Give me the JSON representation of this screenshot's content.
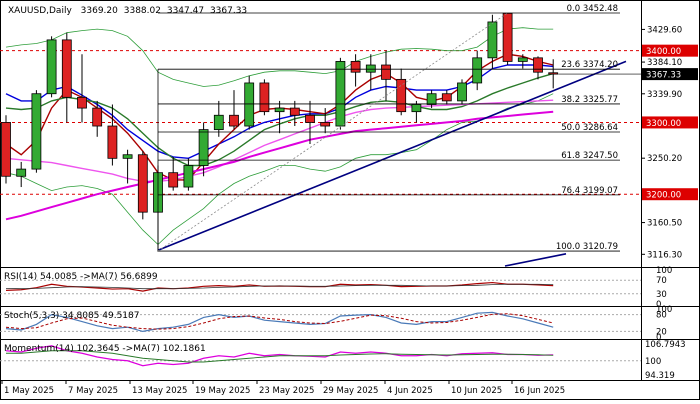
{
  "header": {
    "symbol": "XAUUSD,Daily",
    "open": "3369.20",
    "high": "3388.02",
    "low": "3347.47",
    "close": "3367.33"
  },
  "colors": {
    "bull": "#33aa33",
    "bear": "#dd2222",
    "bb": "#2e9e3a",
    "ma_fast": "#0000dd",
    "ma_red": "#aa0000",
    "ma_green": "#2a7a2a",
    "ma_pink": "#ee55ee",
    "ma_magenta": "#dd00dd",
    "trendline": "#000080",
    "level_red": "#dd0000"
  },
  "chart_data": {
    "type": "candlestick",
    "title": "XAUUSD,Daily",
    "ylim": [
      3100,
      3465
    ],
    "candles": [
      {
        "o": 3300,
        "h": 3310,
        "l": 3215,
        "c": 3225
      },
      {
        "o": 3225,
        "h": 3245,
        "l": 3210,
        "c": 3235
      },
      {
        "o": 3235,
        "h": 3345,
        "l": 3230,
        "c": 3340
      },
      {
        "o": 3340,
        "h": 3420,
        "l": 3335,
        "c": 3415
      },
      {
        "o": 3415,
        "h": 3425,
        "l": 3300,
        "c": 3335
      },
      {
        "o": 3335,
        "h": 3395,
        "l": 3300,
        "c": 3320
      },
      {
        "o": 3320,
        "h": 3330,
        "l": 3280,
        "c": 3295
      },
      {
        "o": 3295,
        "h": 3325,
        "l": 3240,
        "c": 3250
      },
      {
        "o": 3250,
        "h": 3262,
        "l": 3215,
        "c": 3255
      },
      {
        "o": 3255,
        "h": 3260,
        "l": 3165,
        "c": 3175
      },
      {
        "o": 3175,
        "h": 3240,
        "l": 3120,
        "c": 3230
      },
      {
        "o": 3230,
        "h": 3252,
        "l": 3205,
        "c": 3210
      },
      {
        "o": 3210,
        "h": 3250,
        "l": 3205,
        "c": 3240
      },
      {
        "o": 3240,
        "h": 3300,
        "l": 3225,
        "c": 3290
      },
      {
        "o": 3290,
        "h": 3330,
        "l": 3280,
        "c": 3310
      },
      {
        "o": 3310,
        "h": 3345,
        "l": 3290,
        "c": 3295
      },
      {
        "o": 3295,
        "h": 3365,
        "l": 3290,
        "c": 3355
      },
      {
        "o": 3355,
        "h": 3360,
        "l": 3310,
        "c": 3315
      },
      {
        "o": 3315,
        "h": 3330,
        "l": 3285,
        "c": 3320
      },
      {
        "o": 3320,
        "h": 3330,
        "l": 3295,
        "c": 3310
      },
      {
        "o": 3310,
        "h": 3330,
        "l": 3270,
        "c": 3300
      },
      {
        "o": 3300,
        "h": 3320,
        "l": 3285,
        "c": 3295
      },
      {
        "o": 3295,
        "h": 3390,
        "l": 3290,
        "c": 3385
      },
      {
        "o": 3385,
        "h": 3395,
        "l": 3350,
        "c": 3370
      },
      {
        "o": 3370,
        "h": 3395,
        "l": 3345,
        "c": 3380
      },
      {
        "o": 3380,
        "h": 3400,
        "l": 3330,
        "c": 3360
      },
      {
        "o": 3360,
        "h": 3375,
        "l": 3310,
        "c": 3315
      },
      {
        "o": 3315,
        "h": 3330,
        "l": 3300,
        "c": 3325
      },
      {
        "o": 3325,
        "h": 3345,
        "l": 3320,
        "c": 3340
      },
      {
        "o": 3340,
        "h": 3345,
        "l": 3325,
        "c": 3330
      },
      {
        "o": 3330,
        "h": 3360,
        "l": 3325,
        "c": 3355
      },
      {
        "o": 3355,
        "h": 3400,
        "l": 3345,
        "c": 3390
      },
      {
        "o": 3390,
        "h": 3450,
        "l": 3375,
        "c": 3440
      },
      {
        "o": 3452,
        "h": 3452,
        "l": 3380,
        "c": 3385
      },
      {
        "o": 3385,
        "h": 3395,
        "l": 3375,
        "c": 3390
      },
      {
        "o": 3390,
        "h": 3392,
        "l": 3360,
        "c": 3370
      },
      {
        "o": 3369.2,
        "h": 3388.02,
        "l": 3347.47,
        "c": 3367.33
      }
    ],
    "overlays": [
      {
        "key": "bb_upper",
        "values": [
          3405,
          3408,
          3410,
          3415,
          3425,
          3428,
          3430,
          3428,
          3420,
          3400,
          3370,
          3360,
          3355,
          3350,
          3352,
          3358,
          3365,
          3370,
          3372,
          3372,
          3370,
          3368,
          3372,
          3385,
          3392,
          3398,
          3402,
          3403,
          3402,
          3400,
          3400,
          3405,
          3420,
          3430,
          3432,
          3430,
          3430
        ]
      },
      {
        "key": "bb_lower",
        "values": [
          3230,
          3225,
          3215,
          3205,
          3210,
          3212,
          3208,
          3200,
          3175,
          3150,
          3130,
          3150,
          3165,
          3180,
          3200,
          3215,
          3225,
          3232,
          3240,
          3240,
          3235,
          3232,
          3238,
          3250,
          3255,
          3255,
          3258,
          3262,
          3275,
          3290,
          3300,
          3302,
          3310,
          3320,
          3325,
          3330,
          3340
        ]
      },
      {
        "key": "ma_fast",
        "values": [
          3340,
          3330,
          3330,
          3345,
          3350,
          3338,
          3325,
          3310,
          3290,
          3275,
          3260,
          3252,
          3250,
          3260,
          3270,
          3280,
          3292,
          3300,
          3305,
          3310,
          3312,
          3312,
          3320,
          3335,
          3345,
          3350,
          3348,
          3345,
          3345,
          3345,
          3350,
          3360,
          3375,
          3380,
          3380,
          3380,
          3378
        ]
      },
      {
        "key": "ma_red",
        "values": [
          3270,
          3255,
          3275,
          3320,
          3345,
          3335,
          3320,
          3305,
          3285,
          3260,
          3230,
          3220,
          3220,
          3245,
          3270,
          3290,
          3310,
          3318,
          3320,
          3318,
          3315,
          3312,
          3325,
          3345,
          3360,
          3368,
          3355,
          3335,
          3330,
          3335,
          3350,
          3372,
          3385,
          3395,
          3392,
          3385,
          3380
        ]
      },
      {
        "key": "ma_green",
        "values": [
          3320,
          3318,
          3320,
          3330,
          3335,
          3332,
          3328,
          3320,
          3305,
          3285,
          3265,
          3250,
          3240,
          3240,
          3248,
          3260,
          3275,
          3290,
          3298,
          3305,
          3310,
          3310,
          3315,
          3322,
          3328,
          3330,
          3328,
          3322,
          3318,
          3318,
          3322,
          3330,
          3340,
          3348,
          3355,
          3362,
          3368
        ]
      },
      {
        "key": "ma_pink",
        "values": [
          3250,
          3248,
          3246,
          3244,
          3240,
          3236,
          3232,
          3228,
          3222,
          3218,
          3218,
          3220,
          3225,
          3230,
          3238,
          3248,
          3258,
          3268,
          3276,
          3284,
          3292,
          3300,
          3308,
          3314,
          3318,
          3320,
          3321,
          3322,
          3323,
          3324,
          3325,
          3326,
          3327,
          3328,
          3329,
          3330,
          3331
        ]
      },
      {
        "key": "ma_magenta",
        "values": [
          3165,
          3170,
          3176,
          3182,
          3188,
          3194,
          3200,
          3205,
          3210,
          3215,
          3220,
          3225,
          3230,
          3235,
          3240,
          3245,
          3252,
          3258,
          3264,
          3270,
          3276,
          3280,
          3284,
          3288,
          3290,
          3292,
          3294,
          3296,
          3298,
          3300,
          3302,
          3305,
          3307,
          3309,
          3311,
          3313,
          3315
        ]
      }
    ],
    "fibonacci": [
      {
        "label": "0.0",
        "value": 3452.48
      },
      {
        "label": "23.6",
        "value": 3374.2
      },
      {
        "label": "38.2",
        "value": 3325.77
      },
      {
        "label": "50.0",
        "value": 3286.64
      },
      {
        "label": "61.8",
        "value": 3247.5
      },
      {
        "label": "76.4",
        "value": 3199.07
      },
      {
        "label": "100.0",
        "value": 3120.79
      }
    ],
    "levels": [
      3400.0,
      3300.0,
      3200.0
    ],
    "current_price": "3367.33",
    "y_ticks": [
      "3429.60",
      "3384.10",
      "3339.90",
      "3250.20",
      "3160.50",
      "3116.30"
    ],
    "x_ticks": [
      "1 May 2025",
      "7 May 2025",
      "13 May 2025",
      "19 May 2025",
      "23 May 2025",
      "29 May 2025",
      "4 Jun 2025",
      "10 Jun 2025",
      "16 Jun 2025"
    ],
    "indicators": [
      {
        "name": "RSI(14)",
        "value": "54.0085",
        "ma_label": "->MA(7)",
        "ma_value": "56.6899",
        "ticks": [
          "100",
          "70",
          "30",
          "0"
        ]
      },
      {
        "name": "Stoch(5,3,3)",
        "value": "34.8085",
        "ma_label": "",
        "ma_value": "49.5187",
        "ticks": [
          "100",
          "80",
          "20",
          "0"
        ]
      },
      {
        "name": "Momentum(14)",
        "value": "102.3645",
        "ma_label": "->MA(7)",
        "ma_value": "102.1861",
        "ticks": [
          "106.7943",
          "100",
          "94.319"
        ]
      }
    ]
  }
}
